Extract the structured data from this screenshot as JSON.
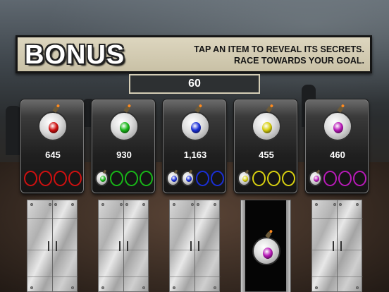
{
  "header": {
    "title": "BONUS",
    "instructions": [
      "TAP AN ITEM TO REVEAL ITS SECRETS.",
      "RACE TOWARDS YOUR GOAL."
    ]
  },
  "counter": {
    "value": "60"
  },
  "cards": [
    {
      "score": "645",
      "color": "#d01010",
      "collected": 0
    },
    {
      "score": "930",
      "color": "#18b818",
      "collected": 1
    },
    {
      "score": "1,163",
      "color": "#1a2fd8",
      "collected": 2
    },
    {
      "score": "455",
      "color": "#d8d010",
      "collected": 1
    },
    {
      "score": "460",
      "color": "#b81ab8",
      "collected": 1
    }
  ],
  "doors": [
    {
      "state": "closed"
    },
    {
      "state": "closed"
    },
    {
      "state": "closed"
    },
    {
      "state": "open",
      "revealed_color": "#b81ab8"
    },
    {
      "state": "closed"
    }
  ]
}
